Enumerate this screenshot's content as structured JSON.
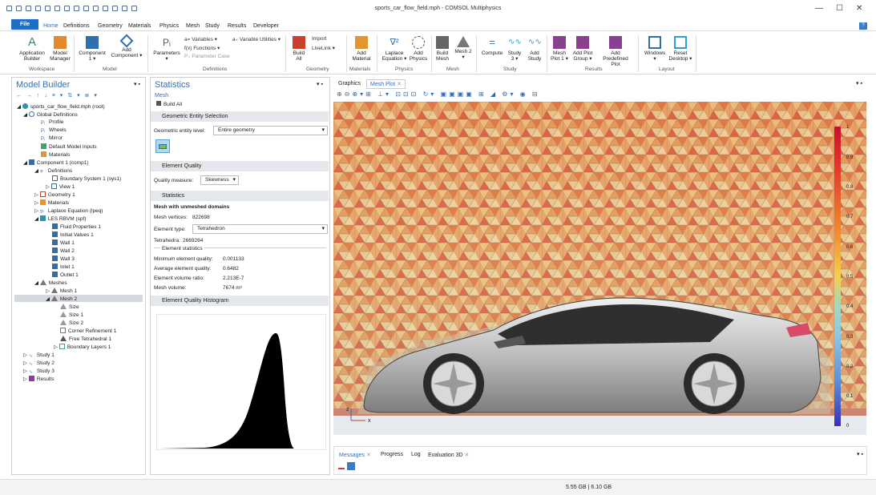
{
  "window": {
    "title": "sports_car_flow_field.mph - COMSOL Multiphysics",
    "minimize": "—",
    "maximize": "☐",
    "close": "✕"
  },
  "menu": {
    "file": "File",
    "tabs": [
      "Home",
      "Definitions",
      "Geometry",
      "Materials",
      "Physics",
      "Mesh",
      "Study",
      "Results",
      "Developer"
    ],
    "help": "?"
  },
  "ribbon": {
    "application_builder": "Application Builder",
    "model_manager": "Model Manager",
    "component": "Component 1 ▾",
    "add_component": "Add Component ▾",
    "parameters": "Parameters ▾",
    "variables": "a= Variables ▾",
    "functions": "f(x) Functions ▾",
    "parameter_case": "P↓ Parameter Case",
    "variable_utilities": "a₊ Variable Utilities ▾",
    "build_all": "Build All",
    "import": "Import",
    "livelink": "LiveLink ▾",
    "add_material": "Add Material",
    "laplace": "Laplace Equation ▾",
    "add_physics": "Add Physics",
    "build_mesh": "Build Mesh",
    "mesh2": "Mesh 2 ▾",
    "compute": "Compute",
    "study3": "Study 3 ▾",
    "add_study": "Add Study",
    "mesh_plot": "Mesh Plot 1 ▾",
    "add_plot_group": "Add Plot Group ▾",
    "add_predefined_plot": "Add Predefined Plot",
    "windows": "Windows ▾",
    "reset_desktop": "Reset Desktop ▾",
    "groups": {
      "workspace": "Workspace",
      "model": "Model",
      "definitions": "Definitions",
      "geometry": "Geometry",
      "materials": "Materials",
      "physics": "Physics",
      "mesh": "Mesh",
      "study": "Study",
      "results": "Results",
      "layout": "Layout"
    }
  },
  "model_builder": {
    "title": "Model Builder",
    "tree": [
      "sports_car_flow_field.mph (root)",
      "Global Definitions",
      "Profile",
      "Wheels",
      "Mirror",
      "Default Model Inputs",
      "Materials",
      "Component 1 (comp1)",
      "Definitions",
      "Boundary System 1 (sys1)",
      "View 1",
      "Geometry 1",
      "Materials",
      "Laplace Equation (lpeq)",
      "LES RBVM (spf)",
      "Fluid Properties 1",
      "Initial Values 1",
      "Wall 1",
      "Wall 2",
      "Wall 3",
      "Inlet 1",
      "Outlet 1",
      "Meshes",
      "Mesh 1",
      "Mesh 2",
      "Size",
      "Size 1",
      "Size 2",
      "Corner Refinement 1",
      "Free Tetrahedral 1",
      "Boundary Layers 1",
      "Study 1",
      "Study 2",
      "Study 3",
      "Results"
    ]
  },
  "statistics": {
    "title": "Statistics",
    "subtitle": "Mesh",
    "build_all": "Build All",
    "geometric_entity_selection": "Geometric Entity Selection",
    "geometric_entity_level_label": "Geometric entity level:",
    "geometric_entity_level": "Entire geometry",
    "element_quality": "Element Quality",
    "quality_measure_label": "Quality measure:",
    "quality_measure": "Skewness",
    "statistics_section": "Statistics",
    "mesh_unmeshed": "Mesh with unmeshed domains",
    "mesh_vertices_label": "Mesh vertices:",
    "mesh_vertices": "822698",
    "element_type_label": "Element type:",
    "element_type": "Tetrahedron",
    "tetrahedra_label": "Tetrahedra:",
    "tetrahedra": "2669284",
    "element_statistics": "Element statistics",
    "min_quality_label": "Minimum element quality:",
    "min_quality": "0.001133",
    "avg_quality_label": "Average element quality:",
    "avg_quality": "0.6482",
    "volume_ratio_label": "Element volume ratio:",
    "volume_ratio": "2.213E-7",
    "mesh_volume_label": "Mesh volume:",
    "mesh_volume": "7674 m³",
    "histogram_title": "Element Quality Histogram"
  },
  "graphics": {
    "tab_graphics": "Graphics",
    "tab_mesh_plot": "Mesh Plot",
    "colorbar_ticks": [
      "1",
      "0.9",
      "0.8",
      "0.7",
      "0.6",
      "0.5",
      "0.4",
      "0.3",
      "0.2",
      "0.1",
      "0"
    ],
    "axis_z": "z",
    "axis_x": "x"
  },
  "messages": {
    "tabs": [
      "Messages",
      "Progress",
      "Log",
      "Evaluation 3D"
    ]
  },
  "status": {
    "memory": "5.55 GB | 6.10 GB"
  },
  "colors": {
    "accent": "#1f6fc4",
    "header": "#3a6fb4",
    "section": "#e4e7ec"
  }
}
